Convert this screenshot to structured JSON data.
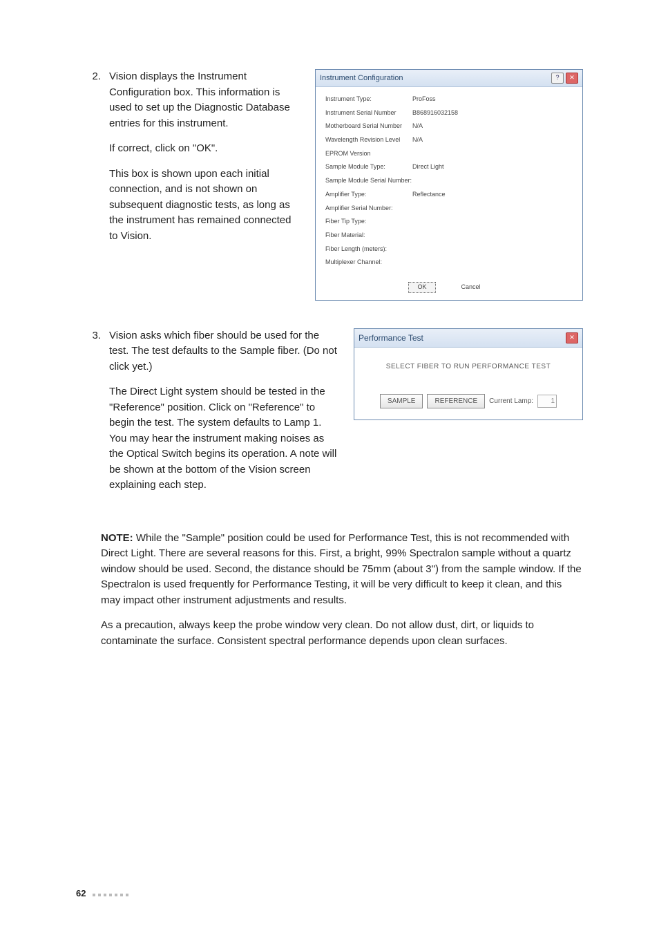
{
  "step2": {
    "num": "2.",
    "p1": "Vision displays the Instrument Configuration box. This information is used to set up the Diagnostic Database entries for this instrument.",
    "p2": "If correct, click on \"OK\".",
    "p3": "This box is shown upon each initial connection, and is not shown on subsequent diagnostic tests, as long as the instrument has remained connected to Vision."
  },
  "step3": {
    "num": "3.",
    "p1": "Vision asks which fiber should be used for the test. The test defaults to the Sample fiber. (Do not click yet.)",
    "p2": "The Direct Light system should be tested in the \"Reference\" position. Click on \"Reference\" to begin the test. The system defaults to Lamp 1. You may hear the instrument making noises as the Optical Switch begins its operation. A note will be shown at the bottom of the Vision screen explaining each step."
  },
  "note": {
    "label": "NOTE:",
    "p1": " While the \"Sample\" position could be used for Performance Test, this is not recommended with Direct Light. There are several reasons for this. First, a bright, 99% Spectralon sample without a quartz window should be used. Second, the distance should be 75mm (about 3\") from the sample window. If the Spectralon is used frequently for Performance Testing, it will be very difficult to keep it clean, and this may impact other instrument adjustments and results.",
    "p2": "As a precaution, always keep the probe window very clean. Do not allow dust, dirt, or liquids to contaminate the surface. Consistent spectral performance depends upon clean surfaces."
  },
  "dlg1": {
    "title": "Instrument Configuration",
    "rows": [
      {
        "label": "Instrument Type:",
        "value": "ProFoss"
      },
      {
        "label": "Instrument Serial Number",
        "value": "B868916032158"
      },
      {
        "label": "Motherboard Serial Number",
        "value": "N/A"
      },
      {
        "label": "Wavelength Revision Level",
        "value": "N/A"
      },
      {
        "label": "EPROM Version",
        "value": ""
      },
      {
        "label": "Sample Module Type:",
        "value": "Direct Light"
      },
      {
        "label": "Sample Module Serial Number:",
        "value": ""
      },
      {
        "label": "Amplifier Type:",
        "value": "Reflectance"
      },
      {
        "label": "Amplifier Serial Number:",
        "value": ""
      },
      {
        "label": "Fiber Tip Type:",
        "value": ""
      },
      {
        "label": "Fiber Material:",
        "value": ""
      },
      {
        "label": "Fiber Length (meters):",
        "value": ""
      },
      {
        "label": "Multiplexer Channel:",
        "value": ""
      }
    ],
    "ok": "OK",
    "cancel": "Cancel"
  },
  "dlg2": {
    "title": "Performance Test",
    "msg": "SELECT FIBER TO RUN PERFORMANCE TEST",
    "sample": "SAMPLE",
    "reference": "REFERENCE",
    "lamp_label": "Current Lamp:",
    "lamp_value": "1"
  },
  "footer": {
    "page": "62"
  }
}
